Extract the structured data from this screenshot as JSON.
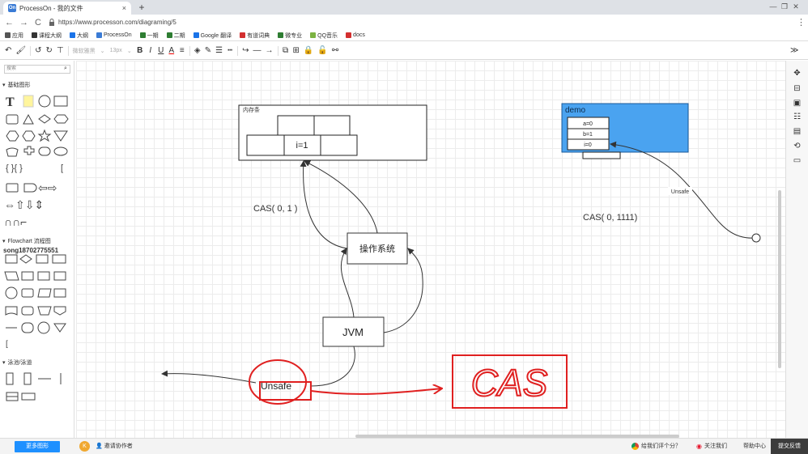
{
  "browser": {
    "tab_title": "ProcessOn - 我的文件",
    "tab_close": "×",
    "new_tab": "+",
    "window_controls": [
      "—",
      "❐",
      "✕"
    ],
    "back": "←",
    "forward": "→",
    "reload": "C",
    "secure_icon": "lock-icon",
    "url": "https://www.processon.com/diagraming/5",
    "menu": "⋮",
    "apps_label": "应用"
  },
  "bookmarks": [
    {
      "label": "应用",
      "color": "#555"
    },
    {
      "label": "课程大纲",
      "color": "#333"
    },
    {
      "label": "大纲",
      "color": "#1a73e8"
    },
    {
      "label": "ProcessOn",
      "color": "#3a7bd5"
    },
    {
      "label": "一期",
      "color": "#2e7d32"
    },
    {
      "label": "二期",
      "color": "#2e7d32"
    },
    {
      "label": "Google 翻译",
      "color": "#1a73e8"
    },
    {
      "label": "有道词典",
      "color": "#d32f2f"
    },
    {
      "label": "微专业",
      "color": "#2e7d32"
    },
    {
      "label": "QQ音乐",
      "color": "#7cb342"
    },
    {
      "label": "docs",
      "color": "#d32f2f"
    }
  ],
  "toolbar": {
    "font_family": "微软雅黑",
    "font_size": "13px",
    "bold": "B",
    "italic": "I",
    "underline": "U",
    "font_color": "A",
    "expand": "≫"
  },
  "sidebar": {
    "search_placeholder": "搜索",
    "section_basic": "基础图形",
    "section_flowchart": "Flowchart 流程图",
    "overlay_text": "song18702775551",
    "section_swimlane": "泳池/泳道",
    "collapse": "▾"
  },
  "diagram": {
    "memory_label": "内存条",
    "i_cell": "i=1",
    "demo_title": "demo",
    "demo_fields": [
      "a=0",
      "b=1",
      "i=0"
    ],
    "cas_left": "CAS(  0, 1  )",
    "cas_right": "CAS( 0,  1111)",
    "os_label": "操作系统",
    "jvm_label": "JVM",
    "unsafe_label": "Unsafe",
    "unsafe_edge_label": "Unsafe",
    "handwritten": "CAS"
  },
  "status": {
    "more_shapes": "更多图形",
    "avatar_letter": "K",
    "invite": "邀请协作者",
    "rate": "给我们评个分？",
    "follow": "关注我们",
    "help": "帮助中心",
    "feedback": "提交反馈"
  },
  "colors": {
    "demo_fill": "#4aa3f0",
    "annotation_red": "#e02020",
    "accent_blue": "#1e90ff"
  }
}
